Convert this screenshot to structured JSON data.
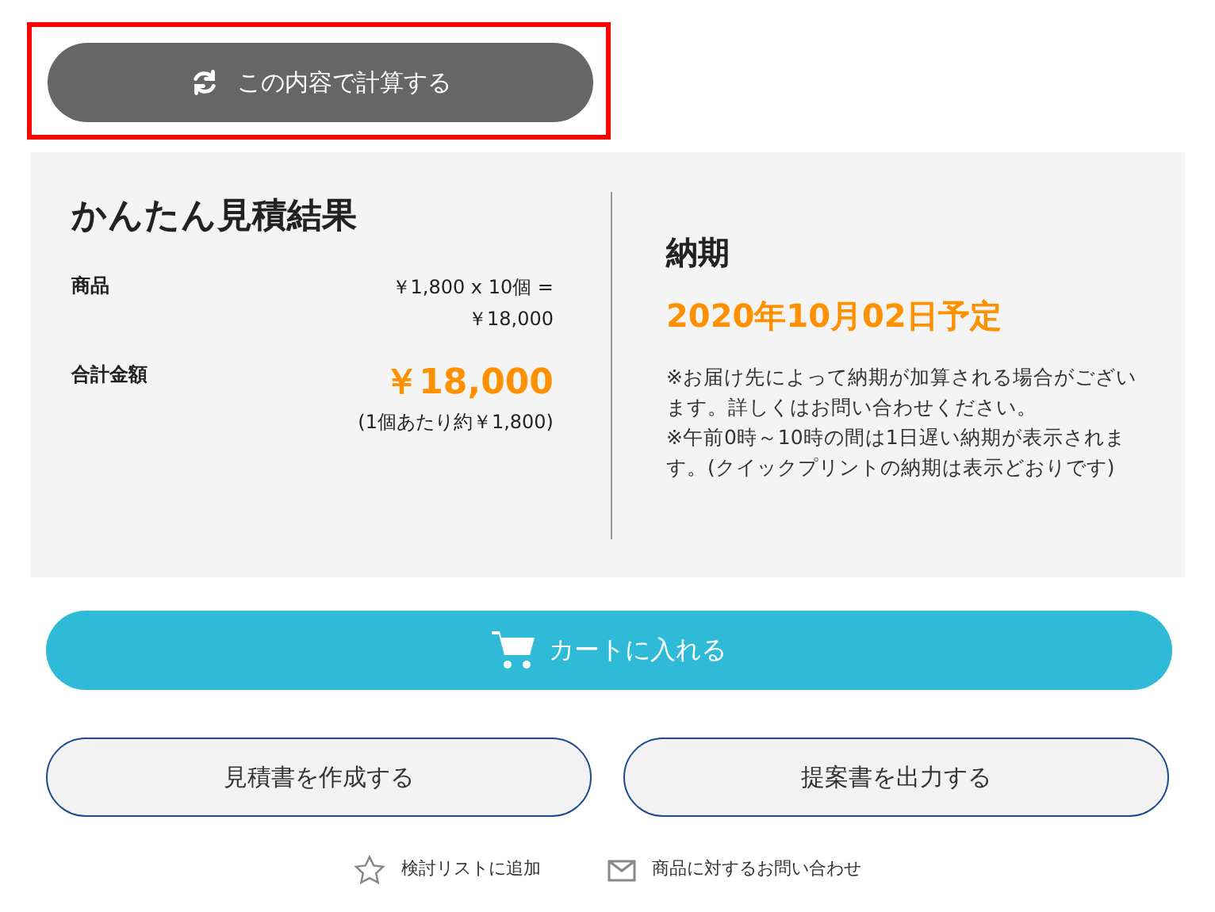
{
  "calculate_button": {
    "label": "この内容で計算する",
    "highlighted": true
  },
  "estimate": {
    "title": "かんたん見積結果",
    "rows": [
      {
        "label": "商品",
        "value_lines": [
          "￥1,800 x 10個 =",
          "￥18,000"
        ]
      }
    ],
    "total": {
      "label": "合計金額",
      "amount": "￥18,000",
      "per_unit": "(1個あたり約￥1,800)"
    }
  },
  "delivery": {
    "title": "納期",
    "date": "2020年10月02日予定",
    "notes": [
      "※お届け先によって納期が加算される場合がございます。詳しくはお問い合わせください。",
      "※午前0時～10時の間は1日遅い納期が表示されます。(クイックプリントの納期は表示どおりです)"
    ]
  },
  "cart_button": {
    "label": "カートに入れる"
  },
  "secondary_buttons": [
    {
      "label": "見積書を作成する"
    },
    {
      "label": "提案書を出力する"
    }
  ],
  "links": [
    {
      "kind": "star",
      "label": "検討リストに追加"
    },
    {
      "kind": "mail",
      "label": "商品に対するお問い合わせ"
    }
  ]
}
